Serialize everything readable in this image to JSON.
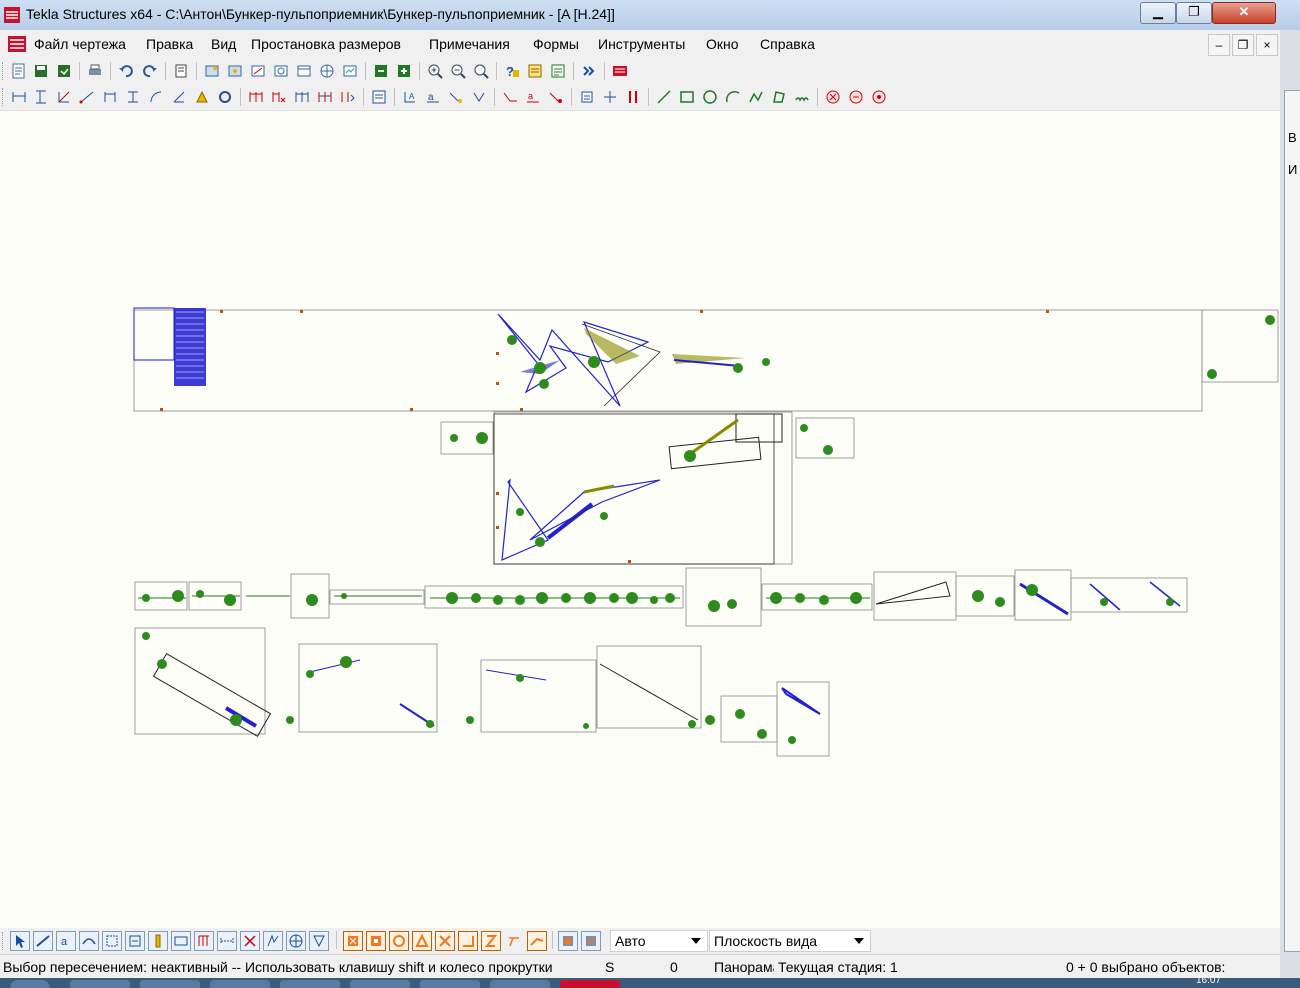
{
  "window": {
    "title": "Tekla Structures x64 - C:\\Антон\\Бункер-пульпоприемник\\Бункер-пульпоприемник  - [A   [H.24]]",
    "minimize_glyph": "▁",
    "maximize_glyph": "❐",
    "close_glyph": "✕"
  },
  "menu": {
    "items": [
      "Файл чертежа",
      "Правка",
      "Вид",
      "Простановка размеров",
      "Примечания",
      "Формы",
      "Инструменты",
      "Окно",
      "Справка"
    ],
    "mdi_minimize": "–",
    "mdi_restore": "❐",
    "mdi_close": "×"
  },
  "bottom_toolbar": {
    "combo_scale": "Авто",
    "combo_plane": "Плоскость вида"
  },
  "status": {
    "hint": "Выбор пересечением: неактивный -- Использовать клавишу shift и колесо прокрутки",
    "snap_letter": "S",
    "counter": "0",
    "pan": "Панорама",
    "stage": "Текущая стадия: 1",
    "selected": "0 + 0 выбрано объектов:"
  },
  "right_panel": {
    "letter_1": "В",
    "letter_2": "И"
  },
  "taskbar": {
    "clock": "16:07"
  },
  "colors": {
    "canvas": "#fefef9",
    "accent_blue": "#0000cc",
    "accent_green": "#2e8b1e",
    "accent_olive": "#8a8a00"
  }
}
